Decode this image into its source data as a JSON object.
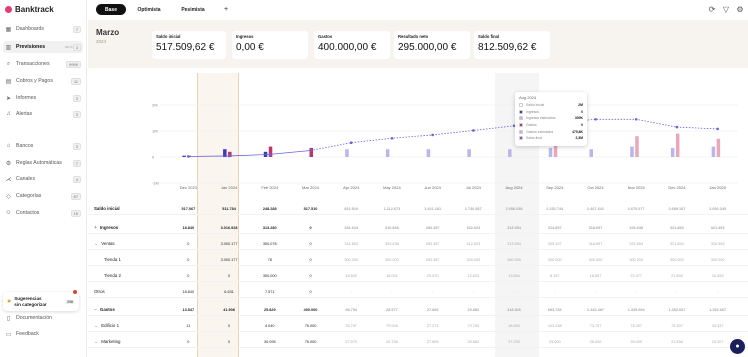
{
  "app": {
    "name": "Banktrack"
  },
  "sidebar": {
    "items": [
      {
        "icon": "grid-icon",
        "glyph": "▦",
        "label": "Dashboards",
        "count": "7",
        "top": 29
      },
      {
        "icon": "forecast-icon",
        "glyph": "▥",
        "label": "Previsiones",
        "beta": "BETA",
        "count": "3",
        "top": 47,
        "active": true
      },
      {
        "icon": "search-icon",
        "glyph": "⌕",
        "label": "Transacciones",
        "count": "9999",
        "top": 64
      },
      {
        "icon": "document-icon",
        "glyph": "▤",
        "label": "Cobros y Pagos",
        "count": "11",
        "top": 81
      },
      {
        "icon": "send-icon",
        "glyph": "➤",
        "label": "Informes",
        "count": "3",
        "top": 98
      },
      {
        "icon": "bell-icon",
        "glyph": "♫",
        "label": "Alertas",
        "count": "3",
        "top": 114
      },
      {
        "icon": "bank-icon",
        "glyph": "⌂",
        "label": "Bancos",
        "count": "3",
        "top": 146
      },
      {
        "icon": "rules-icon",
        "glyph": "⚙",
        "label": "Reglas Automáticas",
        "count": "7",
        "top": 163
      },
      {
        "icon": "share-icon",
        "glyph": "⋌",
        "label": "Canales",
        "count": "4",
        "top": 179
      },
      {
        "icon": "tag-icon",
        "glyph": "◇",
        "label": "Categorías",
        "count": "87",
        "top": 196
      },
      {
        "icon": "contacts-icon",
        "glyph": "☺",
        "label": "Contactos",
        "count": "15",
        "top": 213
      },
      {
        "icon": "book-icon",
        "glyph": "▯",
        "label": "Documentación",
        "count": "",
        "top": 318
      },
      {
        "icon": "chat-icon",
        "glyph": "▭",
        "label": "Feedback",
        "count": "",
        "top": 334
      }
    ],
    "promo": {
      "text1": "Sugerencias",
      "text2": "sin categorizar",
      "badge": "208"
    }
  },
  "tabs": [
    {
      "label": "Base",
      "active": true
    },
    {
      "label": "Optimista"
    },
    {
      "label": "Pesimista"
    },
    {
      "label": "+"
    }
  ],
  "header": {
    "month": "Marzo",
    "year": "2024",
    "cards": [
      {
        "label": "Saldo inicial",
        "value": "517.509,62 €"
      },
      {
        "label": "Ingresos",
        "value": "0,00 €"
      },
      {
        "label": "Gastos",
        "value": "400.000,00 €"
      },
      {
        "label": "Resultado neto",
        "value": "295.000,00 €"
      },
      {
        "label": "Saldo final",
        "value": "812.509,62 €"
      }
    ]
  },
  "chart_data": {
    "type": "bar",
    "categories": [
      "Dec 2023",
      "Jan 2024",
      "Feb 2024",
      "Mar 2024",
      "Apr 2024",
      "May 2024",
      "Jun 2024",
      "Jul 2024",
      "Aug 2024",
      "Sep 2024",
      "Oct 2024",
      "Nov 2024",
      "Dec 2024",
      "Jan 2025"
    ],
    "ylabels": [
      "2M",
      "1M",
      "0",
      "-1M"
    ],
    "yticks": [
      2,
      1,
      0,
      -1
    ],
    "ylim": [
      -1,
      2
    ],
    "colors": {
      "ingresos": "#3b3bb8",
      "gastos": "#c0336a",
      "ingresos_est": "#b9b6ec",
      "gastos_est": "#eaa6ba",
      "balance": "#6a63d6"
    },
    "series_ingresos": [
      0.05,
      0.3,
      0.2,
      0,
      0.3,
      0.3,
      0.3,
      0.3,
      0.3,
      0.35,
      0.3,
      0.4,
      0.35,
      0.4
    ],
    "series_gastos": [
      0.05,
      0.2,
      0.4,
      0.35,
      0,
      0,
      0,
      0,
      0,
      0.45,
      0,
      0.8,
      0.9,
      0.7
    ],
    "balance": [
      0.02,
      0.04,
      0.1,
      0.25,
      0.55,
      0.72,
      0.85,
      1.02,
      1.2,
      1.3,
      1.45,
      1.45,
      1.15,
      1.08
    ],
    "tooltip": {
      "title": "Aug 2024",
      "rows": [
        {
          "name": "Saldo inicial",
          "value": "2M",
          "color": "#ffffff"
        },
        {
          "name": "Ingresos",
          "value": "0",
          "color": "#3b3bb8"
        },
        {
          "name": "Ingresos estimados",
          "value": "300K",
          "color": "#b9b6ec"
        },
        {
          "name": "Gastos",
          "value": "0",
          "color": "#c0336a"
        },
        {
          "name": "Gastos estimados",
          "value": "475,8K",
          "color": "#eaa6ba"
        },
        {
          "name": "Saldo final",
          "value": "2,3M",
          "color": "#6a63d6"
        }
      ]
    }
  },
  "table": {
    "months": [
      "Dec 2023",
      "Jan 2024",
      "Feb 2024",
      "Mar 2024",
      "Apr 2024",
      "May 2024",
      "Jun 2024",
      "Jul 2024",
      "Aug 2024",
      "Sep 2024",
      "Oct 2024",
      "Nov 2024",
      "Dec 2024",
      "Jan 2025"
    ],
    "rows": [
      {
        "label": "Saldo inicial",
        "bold": true,
        "values": [
          "517.067",
          "511.784",
          "248.288",
          "517.510",
          "812.510",
          "1.112.673",
          "1.421.181",
          "1.736.837",
          "2.058.058",
          "2.252.744",
          "2.467.641",
          "2.670.077",
          "2.689.187",
          "2.692.345"
        ]
      },
      {
        "label": "Ingresos",
        "bold": true,
        "ex": "+",
        "icon": "●",
        "iconColor": "#3aa757",
        "values": [
          "18.840",
          "3.016.928",
          "313.280",
          "0",
          "332.623",
          "310.838",
          "283.457",
          "332.623",
          "313.594",
          "314.897",
          "318.697",
          "326.638",
          "321.894",
          "321.493"
        ]
      },
      {
        "label": "Ventas",
        "ex": "⌄",
        "values": [
          "0",
          "3.000.177",
          "300.078",
          "0",
          "318.600",
          "303.438",
          "283.457",
          "312.623",
          "313.594",
          "309.197",
          "318.697",
          "322.654",
          "321.894",
          "316.393"
        ]
      },
      {
        "label": "Tienda 1",
        "indent": true,
        "values": [
          "0",
          "3.000.177",
          "78",
          "0",
          "300.000",
          "300.000",
          "263.387",
          "300.000",
          "300.000",
          "300.000",
          "300.000",
          "300.000",
          "300.000",
          "300.000"
        ]
      },
      {
        "label": "Tienda 2",
        "indent": true,
        "values": [
          "0",
          "0",
          "300.000",
          "0",
          "18.600",
          "18.001",
          "20.070",
          "12.623",
          "13.594",
          "8.197",
          "18.697",
          "22.477",
          "21.894",
          "16.393"
        ]
      },
      {
        "label": "Otros",
        "values": [
          "18.840",
          "6.631",
          "7.571",
          "0",
          "-",
          "-",
          "-",
          "-",
          "-",
          "-",
          "-",
          "-",
          "-",
          "-"
        ]
      },
      {
        "label": "Gastos",
        "bold": true,
        "ex": "−",
        "icon": "●",
        "iconColor": "#d0483e",
        "values": [
          "13.547",
          "41.908",
          "25.829",
          "400.000",
          "98.754",
          "28.577",
          "27.806",
          "25.882",
          "418.826",
          "683.736",
          "2.342.487",
          "1.339.954",
          "1.352.687",
          "1.352.687"
        ]
      },
      {
        "label": "Edificio 1",
        "ex": "⌄",
        "values": [
          "11",
          "0",
          "4.040",
          "75.000",
          "78.797",
          "79.928",
          "27.273",
          "73.700",
          "18.830",
          "103.238",
          "73.797",
          "78.267",
          "73.307",
          "33.337"
        ]
      },
      {
        "label": "Marketing",
        "ex": "⌄",
        "values": [
          "0",
          "0",
          "30.095",
          "75.000",
          "27.570",
          "25.738",
          "27.806",
          "25.882",
          "27.290",
          "25.000",
          "25.000",
          "26.009",
          "21.838",
          "23.307"
        ]
      }
    ]
  },
  "chat": {
    "icon": "chat-bubble-icon"
  }
}
